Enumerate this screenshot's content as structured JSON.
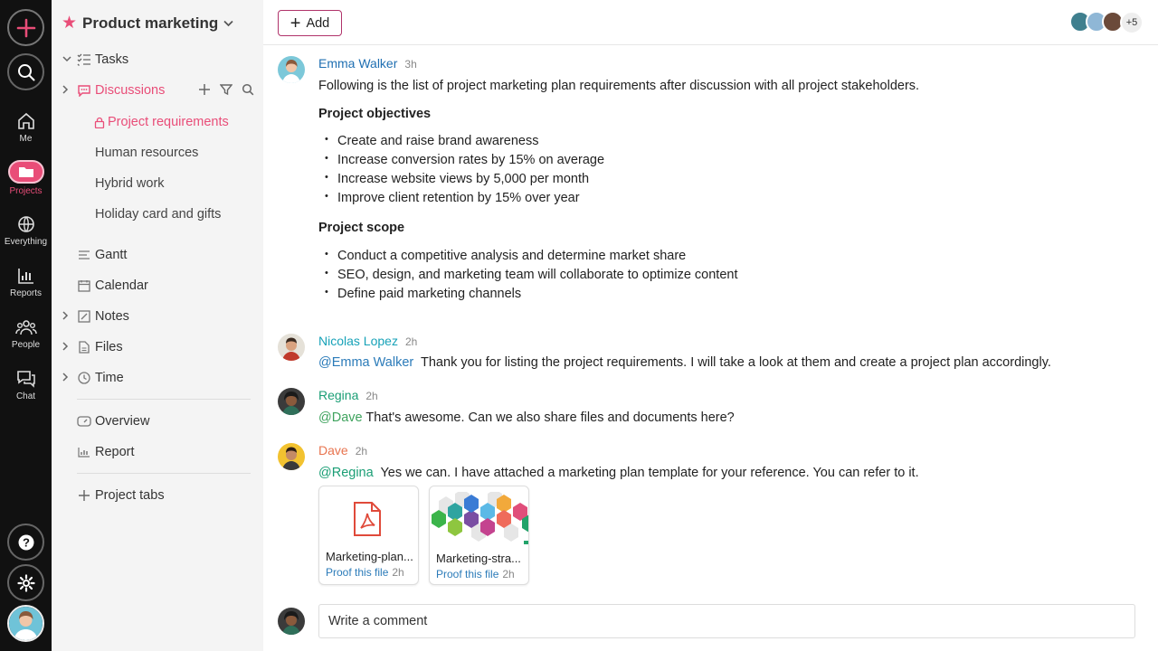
{
  "rail": {
    "nav": [
      {
        "label": "Me",
        "icon": "home-icon"
      },
      {
        "label": "Projects",
        "icon": "folder-icon"
      },
      {
        "label": "Everything",
        "icon": "globe-icon"
      },
      {
        "label": "Reports",
        "icon": "bar-chart-icon"
      },
      {
        "label": "People",
        "icon": "people-icon"
      },
      {
        "label": "Chat",
        "icon": "chat-icon"
      }
    ],
    "accent": "#e94d78"
  },
  "sidebar": {
    "project_title": "Product marketing",
    "tasks": "Tasks",
    "discussions": "Discussions",
    "discussion_items": [
      "Project requirements",
      "Human resources",
      "Hybrid work",
      "Holiday card and gifts"
    ],
    "views": [
      "Gantt",
      "Calendar",
      "Notes",
      "Files",
      "Time"
    ],
    "extra": [
      "Overview",
      "Report"
    ],
    "project_tabs": "Project tabs"
  },
  "topbar": {
    "add_label": "Add",
    "more_members": "+5"
  },
  "messages": [
    {
      "author": "Emma Walker",
      "time": "3h",
      "color": "#1f6fb2",
      "intro": "Following is the list of project marketing plan requirements after discussion with all project stakeholders.",
      "objectives_title": "Project objectives",
      "objectives": [
        "Create and raise brand awareness",
        "Increase conversion rates by 15% on average",
        "Increase website views by 5,000 per month",
        "Improve client retention by 15% over year"
      ],
      "scope_title": "Project scope",
      "scope": [
        "Conduct a competitive analysis and determine market share",
        "SEO, design, and marketing team will collaborate to optimize content",
        "Define paid marketing channels"
      ]
    },
    {
      "author": "Nicolas Lopez",
      "time": "2h",
      "color": "#17a2b8",
      "mention": "@Emma Walker",
      "text": "Thank you for listing the project requirements. I will take a look at them and create a project plan accordingly."
    },
    {
      "author": "Regina",
      "time": "2h",
      "color": "#1a9e75",
      "mention": "@Dave",
      "text": "That's awesome. Can we also share files and documents here?"
    },
    {
      "author": "Dave",
      "time": "2h",
      "color": "#e8744f",
      "mention": "@Regina",
      "text": "Yes we can. I have attached a marketing plan template for your reference. You can refer to it.",
      "attachments": [
        {
          "name": "Marketing-plan...",
          "proof": "Proof this file",
          "time": "2h"
        },
        {
          "name": "Marketing-stra...",
          "proof": "Proof this file",
          "time": "2h"
        }
      ]
    }
  ],
  "comment": {
    "placeholder": "Write a comment"
  }
}
